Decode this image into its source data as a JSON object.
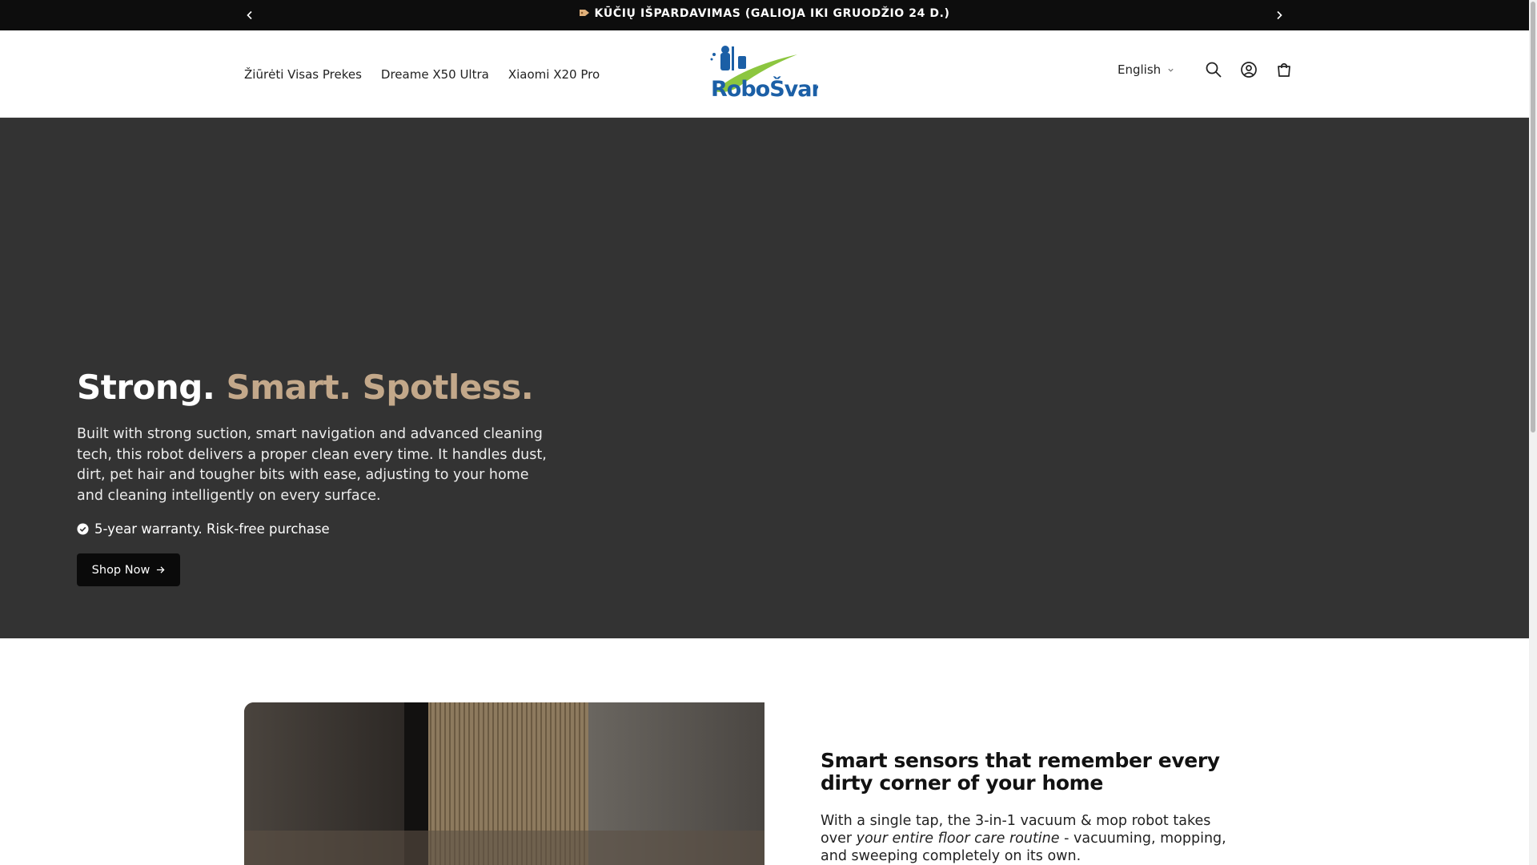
{
  "announcement": {
    "text": "KŪČIŲ IŠPARDAVIMAS (GALIOJA IKI GRUODŽIO 24 D.)",
    "icon": "tag-icon",
    "prev_icon": "chevron-left-icon",
    "next_icon": "chevron-right-icon"
  },
  "header": {
    "nav": [
      {
        "label": "Žiūrėti Visas Prekes"
      },
      {
        "label": "Dreame X50 Ultra"
      },
      {
        "label": "Xiaomi X20 Pro"
      }
    ],
    "logo_text": "RoboŠvara",
    "language": "English",
    "icons": [
      "search-icon",
      "account-icon",
      "cart-icon"
    ]
  },
  "hero": {
    "title_part1": "Strong.",
    "title_part2": "Smart. Spotless.",
    "description": "Built with strong suction, smart navigation and advanced cleaning tech, this robot delivers a proper clean every time. It handles dust, dirt, pet hair and tougher bits with ease, adjusting to your home and cleaning intelligently on every surface.",
    "warranty": "5-year warranty. Risk-free purchase",
    "button_label": "Shop Now",
    "background_color": "#333333",
    "accent_color": "#c3a88a"
  },
  "feature": {
    "title": "Smart sensors that remember every dirty corner of your home",
    "body_part1": "With a single tap, the 3-in-1 vacuum & mop robot takes over ",
    "body_emphasis": "your entire floor care routine",
    "body_part2": " - vacuuming, mopping, and sweeping completely on its own."
  }
}
